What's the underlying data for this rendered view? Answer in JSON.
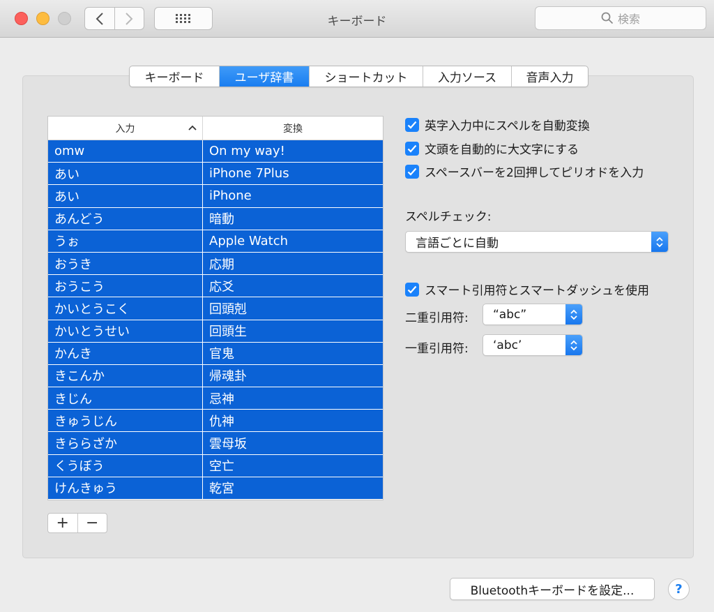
{
  "window": {
    "title": "キーボード",
    "search_placeholder": "検索"
  },
  "tabs": [
    {
      "label": "キーボード",
      "active": false
    },
    {
      "label": "ユーザ辞書",
      "active": true
    },
    {
      "label": "ショートカット",
      "active": false
    },
    {
      "label": "入力ソース",
      "active": false
    },
    {
      "label": "音声入力",
      "active": false
    }
  ],
  "table": {
    "columns": [
      "入力",
      "変換"
    ],
    "rows": [
      [
        "omw",
        "On my way!"
      ],
      [
        "あい",
        "iPhone 7Plus"
      ],
      [
        "あい",
        "iPhone"
      ],
      [
        "あんどう",
        "暗動"
      ],
      [
        "うぉ",
        "Apple Watch"
      ],
      [
        "おうき",
        "応期"
      ],
      [
        "おうこう",
        "応爻"
      ],
      [
        "かいとうこく",
        "回頭剋"
      ],
      [
        "かいとうせい",
        "回頭生"
      ],
      [
        "かんき",
        "官鬼"
      ],
      [
        "きこんか",
        "帰魂卦"
      ],
      [
        "きじん",
        "忌神"
      ],
      [
        "きゅうじん",
        "仇神"
      ],
      [
        "きららざか",
        "雲母坂"
      ],
      [
        "くうぼう",
        "空亡"
      ],
      [
        "けんきゅう",
        "乾宮"
      ]
    ],
    "add_label": "+",
    "remove_label": "−"
  },
  "options": {
    "auto_correct": "英字入力中にスペルを自動変換",
    "auto_capitalize": "文頭を自動的に大文字にする",
    "double_space_period": "スペースバーを2回押してピリオドを入力",
    "spell_check_label": "スペルチェック:",
    "spell_check_value": "言語ごとに自動",
    "smart_quotes": "スマート引用符とスマートダッシュを使用",
    "double_quote_label": "二重引用符:",
    "double_quote_value": "“abc”",
    "single_quote_label": "一重引用符:",
    "single_quote_value": "‘abc’"
  },
  "footer": {
    "bluetooth_button": "Bluetoothキーボードを設定...",
    "help_label": "?"
  },
  "colors": {
    "accent": "#1a7ef0",
    "selection": "#0b62d6"
  }
}
